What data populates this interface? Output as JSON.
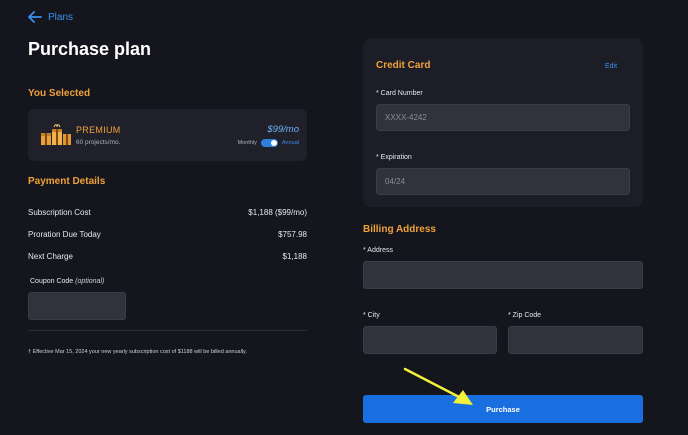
{
  "nav": {
    "back_label": "Plans"
  },
  "page": {
    "title": "Purchase plan"
  },
  "selection": {
    "section_title": "You Selected",
    "plan_name": "PREMIUM",
    "plan_sub": "60 projects/mo.",
    "price": "$99/mo",
    "toggle_left": "Monthly",
    "toggle_right": "Annual",
    "billing_annual": true
  },
  "payment": {
    "section_title": "Payment Details",
    "rows": [
      {
        "label": "Subscription Cost",
        "value": "$1,188 ($99/mo)"
      },
      {
        "label": "Proration Due Today",
        "value": "$757.98"
      },
      {
        "label": "Next Charge",
        "value": "$1,188"
      }
    ],
    "coupon_label": "Coupon Code",
    "coupon_optional": "(optional)",
    "coupon_value": ""
  },
  "footnote": "† Effective Mar 15, 2024 your new yearly subscription cost of $1188 will be billed annually.",
  "credit_card": {
    "title": "Credit Card",
    "edit_label": "Edit",
    "card_number_label": "* Card Number",
    "card_number_value": "XXXX-4242",
    "expiration_label": "* Expiration",
    "expiration_value": "04/24"
  },
  "billing": {
    "title": "Billing Address",
    "address_label": "* Address",
    "city_label": "* City",
    "zip_label": "* Zip Code",
    "address_value": "",
    "city_value": "",
    "zip_value": ""
  },
  "actions": {
    "purchase_label": "Purchase"
  },
  "colors": {
    "accent_orange": "#f0a23a",
    "accent_blue": "#3b8ff0",
    "button_blue": "#1a6fe0",
    "annotation_arrow": "#f2f23a"
  }
}
